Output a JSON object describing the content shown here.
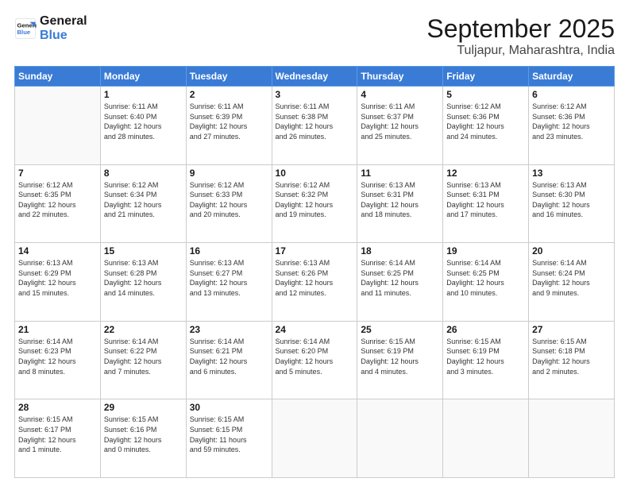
{
  "logo": {
    "line1": "General",
    "line2": "Blue"
  },
  "title": "September 2025",
  "subtitle": "Tuljapur, Maharashtra, India",
  "weekdays": [
    "Sunday",
    "Monday",
    "Tuesday",
    "Wednesday",
    "Thursday",
    "Friday",
    "Saturday"
  ],
  "weeks": [
    [
      {
        "day": "",
        "info": ""
      },
      {
        "day": "1",
        "info": "Sunrise: 6:11 AM\nSunset: 6:40 PM\nDaylight: 12 hours\nand 28 minutes."
      },
      {
        "day": "2",
        "info": "Sunrise: 6:11 AM\nSunset: 6:39 PM\nDaylight: 12 hours\nand 27 minutes."
      },
      {
        "day": "3",
        "info": "Sunrise: 6:11 AM\nSunset: 6:38 PM\nDaylight: 12 hours\nand 26 minutes."
      },
      {
        "day": "4",
        "info": "Sunrise: 6:11 AM\nSunset: 6:37 PM\nDaylight: 12 hours\nand 25 minutes."
      },
      {
        "day": "5",
        "info": "Sunrise: 6:12 AM\nSunset: 6:36 PM\nDaylight: 12 hours\nand 24 minutes."
      },
      {
        "day": "6",
        "info": "Sunrise: 6:12 AM\nSunset: 6:36 PM\nDaylight: 12 hours\nand 23 minutes."
      }
    ],
    [
      {
        "day": "7",
        "info": "Sunrise: 6:12 AM\nSunset: 6:35 PM\nDaylight: 12 hours\nand 22 minutes."
      },
      {
        "day": "8",
        "info": "Sunrise: 6:12 AM\nSunset: 6:34 PM\nDaylight: 12 hours\nand 21 minutes."
      },
      {
        "day": "9",
        "info": "Sunrise: 6:12 AM\nSunset: 6:33 PM\nDaylight: 12 hours\nand 20 minutes."
      },
      {
        "day": "10",
        "info": "Sunrise: 6:12 AM\nSunset: 6:32 PM\nDaylight: 12 hours\nand 19 minutes."
      },
      {
        "day": "11",
        "info": "Sunrise: 6:13 AM\nSunset: 6:31 PM\nDaylight: 12 hours\nand 18 minutes."
      },
      {
        "day": "12",
        "info": "Sunrise: 6:13 AM\nSunset: 6:31 PM\nDaylight: 12 hours\nand 17 minutes."
      },
      {
        "day": "13",
        "info": "Sunrise: 6:13 AM\nSunset: 6:30 PM\nDaylight: 12 hours\nand 16 minutes."
      }
    ],
    [
      {
        "day": "14",
        "info": "Sunrise: 6:13 AM\nSunset: 6:29 PM\nDaylight: 12 hours\nand 15 minutes."
      },
      {
        "day": "15",
        "info": "Sunrise: 6:13 AM\nSunset: 6:28 PM\nDaylight: 12 hours\nand 14 minutes."
      },
      {
        "day": "16",
        "info": "Sunrise: 6:13 AM\nSunset: 6:27 PM\nDaylight: 12 hours\nand 13 minutes."
      },
      {
        "day": "17",
        "info": "Sunrise: 6:13 AM\nSunset: 6:26 PM\nDaylight: 12 hours\nand 12 minutes."
      },
      {
        "day": "18",
        "info": "Sunrise: 6:14 AM\nSunset: 6:25 PM\nDaylight: 12 hours\nand 11 minutes."
      },
      {
        "day": "19",
        "info": "Sunrise: 6:14 AM\nSunset: 6:25 PM\nDaylight: 12 hours\nand 10 minutes."
      },
      {
        "day": "20",
        "info": "Sunrise: 6:14 AM\nSunset: 6:24 PM\nDaylight: 12 hours\nand 9 minutes."
      }
    ],
    [
      {
        "day": "21",
        "info": "Sunrise: 6:14 AM\nSunset: 6:23 PM\nDaylight: 12 hours\nand 8 minutes."
      },
      {
        "day": "22",
        "info": "Sunrise: 6:14 AM\nSunset: 6:22 PM\nDaylight: 12 hours\nand 7 minutes."
      },
      {
        "day": "23",
        "info": "Sunrise: 6:14 AM\nSunset: 6:21 PM\nDaylight: 12 hours\nand 6 minutes."
      },
      {
        "day": "24",
        "info": "Sunrise: 6:14 AM\nSunset: 6:20 PM\nDaylight: 12 hours\nand 5 minutes."
      },
      {
        "day": "25",
        "info": "Sunrise: 6:15 AM\nSunset: 6:19 PM\nDaylight: 12 hours\nand 4 minutes."
      },
      {
        "day": "26",
        "info": "Sunrise: 6:15 AM\nSunset: 6:19 PM\nDaylight: 12 hours\nand 3 minutes."
      },
      {
        "day": "27",
        "info": "Sunrise: 6:15 AM\nSunset: 6:18 PM\nDaylight: 12 hours\nand 2 minutes."
      }
    ],
    [
      {
        "day": "28",
        "info": "Sunrise: 6:15 AM\nSunset: 6:17 PM\nDaylight: 12 hours\nand 1 minute."
      },
      {
        "day": "29",
        "info": "Sunrise: 6:15 AM\nSunset: 6:16 PM\nDaylight: 12 hours\nand 0 minutes."
      },
      {
        "day": "30",
        "info": "Sunrise: 6:15 AM\nSunset: 6:15 PM\nDaylight: 11 hours\nand 59 minutes."
      },
      {
        "day": "",
        "info": ""
      },
      {
        "day": "",
        "info": ""
      },
      {
        "day": "",
        "info": ""
      },
      {
        "day": "",
        "info": ""
      }
    ]
  ]
}
